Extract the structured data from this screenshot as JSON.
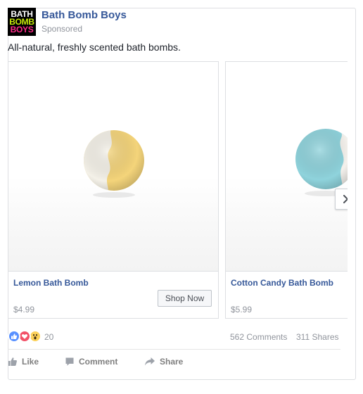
{
  "page": {
    "name": "Bath Bomb Boys",
    "sponsored_label": "Sponsored",
    "logo_lines": [
      "BATH",
      "BOMB",
      "BOYS"
    ]
  },
  "post": {
    "text": "All-natural, freshly scented bath bombs."
  },
  "carousel": {
    "items": [
      {
        "title": "Lemon Bath Bomb",
        "price": "$4.99",
        "cta": "Shop Now",
        "ball_colors": [
          "#f4d47a",
          "#f4f1e8"
        ]
      },
      {
        "title": "Cotton Candy Bath Bomb",
        "price": "$5.99",
        "ball_colors": [
          "#8fd3dc",
          "#f4f1ec"
        ]
      }
    ]
  },
  "engagement": {
    "reaction_count": "20",
    "comments": "562 Comments",
    "shares": "311 Shares"
  },
  "actions": {
    "like": "Like",
    "comment": "Comment",
    "share": "Share"
  },
  "colors": {
    "link_blue": "#365899",
    "meta_gray": "#90949c",
    "border": "#dddfe2"
  }
}
